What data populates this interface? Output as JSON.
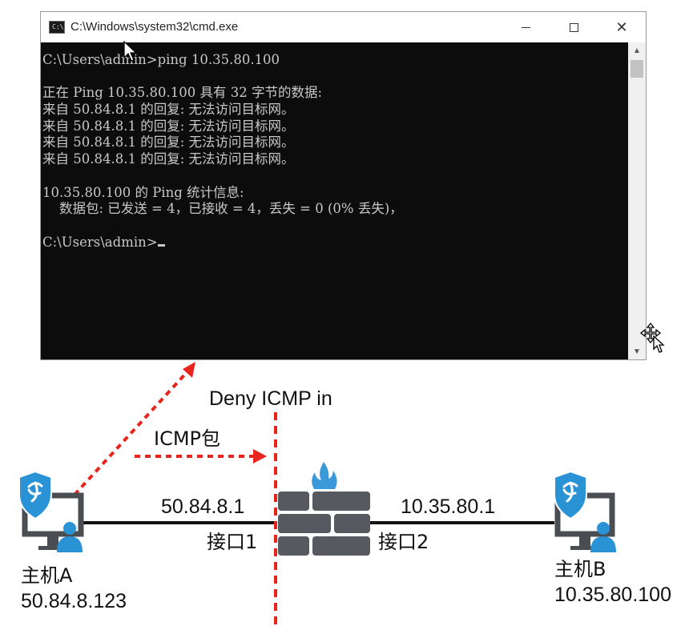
{
  "window": {
    "title": "C:\\Windows\\system32\\cmd.exe",
    "icon_text": "C:\\_",
    "controls": {
      "minimize": "minimize-icon",
      "maximize": "maximize-icon",
      "close": "close-icon"
    },
    "close_glyph": "✕"
  },
  "terminal": {
    "lines": [
      "C:\\Users\\admin>ping 10.35.80.100",
      "",
      "正在 Ping 10.35.80.100 具有 32 字节的数据:",
      "来自 50.84.8.1 的回复: 无法访问目标网。",
      "来自 50.84.8.1 的回复: 无法访问目标网。",
      "来自 50.84.8.1 的回复: 无法访问目标网。",
      "来自 50.84.8.1 的回复: 无法访问目标网。",
      "",
      "10.35.80.100 的 Ping 统计信息:",
      "    数据包: 已发送 = 4，已接收 = 4，丢失 = 0 (0% 丢失)，",
      ""
    ],
    "prompt": "C:\\Users\\admin>"
  },
  "diagram": {
    "rule_label": "Deny ICMP in",
    "packet_label": "ICMP包",
    "host_a": {
      "name": "主机A",
      "ip": "50.84.8.123"
    },
    "host_b": {
      "name": "主机B",
      "ip": "10.35.80.100"
    },
    "interface1": {
      "ip": "50.84.8.1",
      "name": "接口1"
    },
    "interface2": {
      "ip": "10.35.80.1",
      "name": "接口2"
    },
    "colors": {
      "accent_red": "#e8241c",
      "shield_blue": "#2a93d5",
      "firewall_gray": "#565a60",
      "flame_blue": "#3a9ad9"
    }
  }
}
